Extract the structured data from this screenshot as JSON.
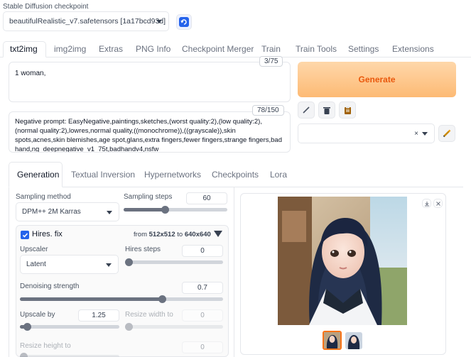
{
  "checkpoint": {
    "label": "Stable Diffusion checkpoint",
    "value": "beautifulRealistic_v7.safetensors [1a17bcd93d]"
  },
  "main_tabs": [
    "txt2img",
    "img2img",
    "Extras",
    "PNG Info",
    "Checkpoint Merger",
    "Train",
    "Train Tools",
    "Settings",
    "Extensions"
  ],
  "prompt": {
    "text": "1 woman,",
    "counter": "3/75"
  },
  "negative_prompt": {
    "text": "Negative prompt: EasyNegative,paintings,sketches,(worst quality:2),(low quality:2),(normal quality:2),lowres,normal quality,((monochrome)),((grayscale)),skin spots,acnes,skin blemishes,age spot,glans,extra fingers,fewer fingers,strange fingers,bad hand,ng_deepnegative_v1_75t,badhandv4,nsfw",
    "counter": "78/150"
  },
  "generate_label": "Generate",
  "sub_tabs": [
    "Generation",
    "Textual Inversion",
    "Hypernetworks",
    "Checkpoints",
    "Lora"
  ],
  "sampling": {
    "method_label": "Sampling method",
    "method_value": "DPM++ 2M Karras",
    "steps_label": "Sampling steps",
    "steps_value": "60",
    "steps_fraction": 0.4
  },
  "hires": {
    "label": "Hires. fix",
    "checked": true,
    "from_text": "from",
    "from_size": "512x512",
    "to_text": "to",
    "to_size": "640x640",
    "upscaler_label": "Upscaler",
    "upscaler_value": "Latent",
    "steps_label": "Hires steps",
    "steps_value": "0",
    "denoise_label": "Denoising strength",
    "denoise_value": "0.7",
    "denoise_fraction": 0.7,
    "upscale_label": "Upscale by",
    "upscale_value": "1.25",
    "upscale_fraction": 0.07,
    "resize_w_label": "Resize width to",
    "resize_w_value": "0",
    "resize_h_label": "Resize height to",
    "resize_h_value": "0"
  },
  "colors": {
    "accent": "#f97316",
    "generate_bg": "#fed7aa",
    "checkbox": "#2563eb"
  }
}
